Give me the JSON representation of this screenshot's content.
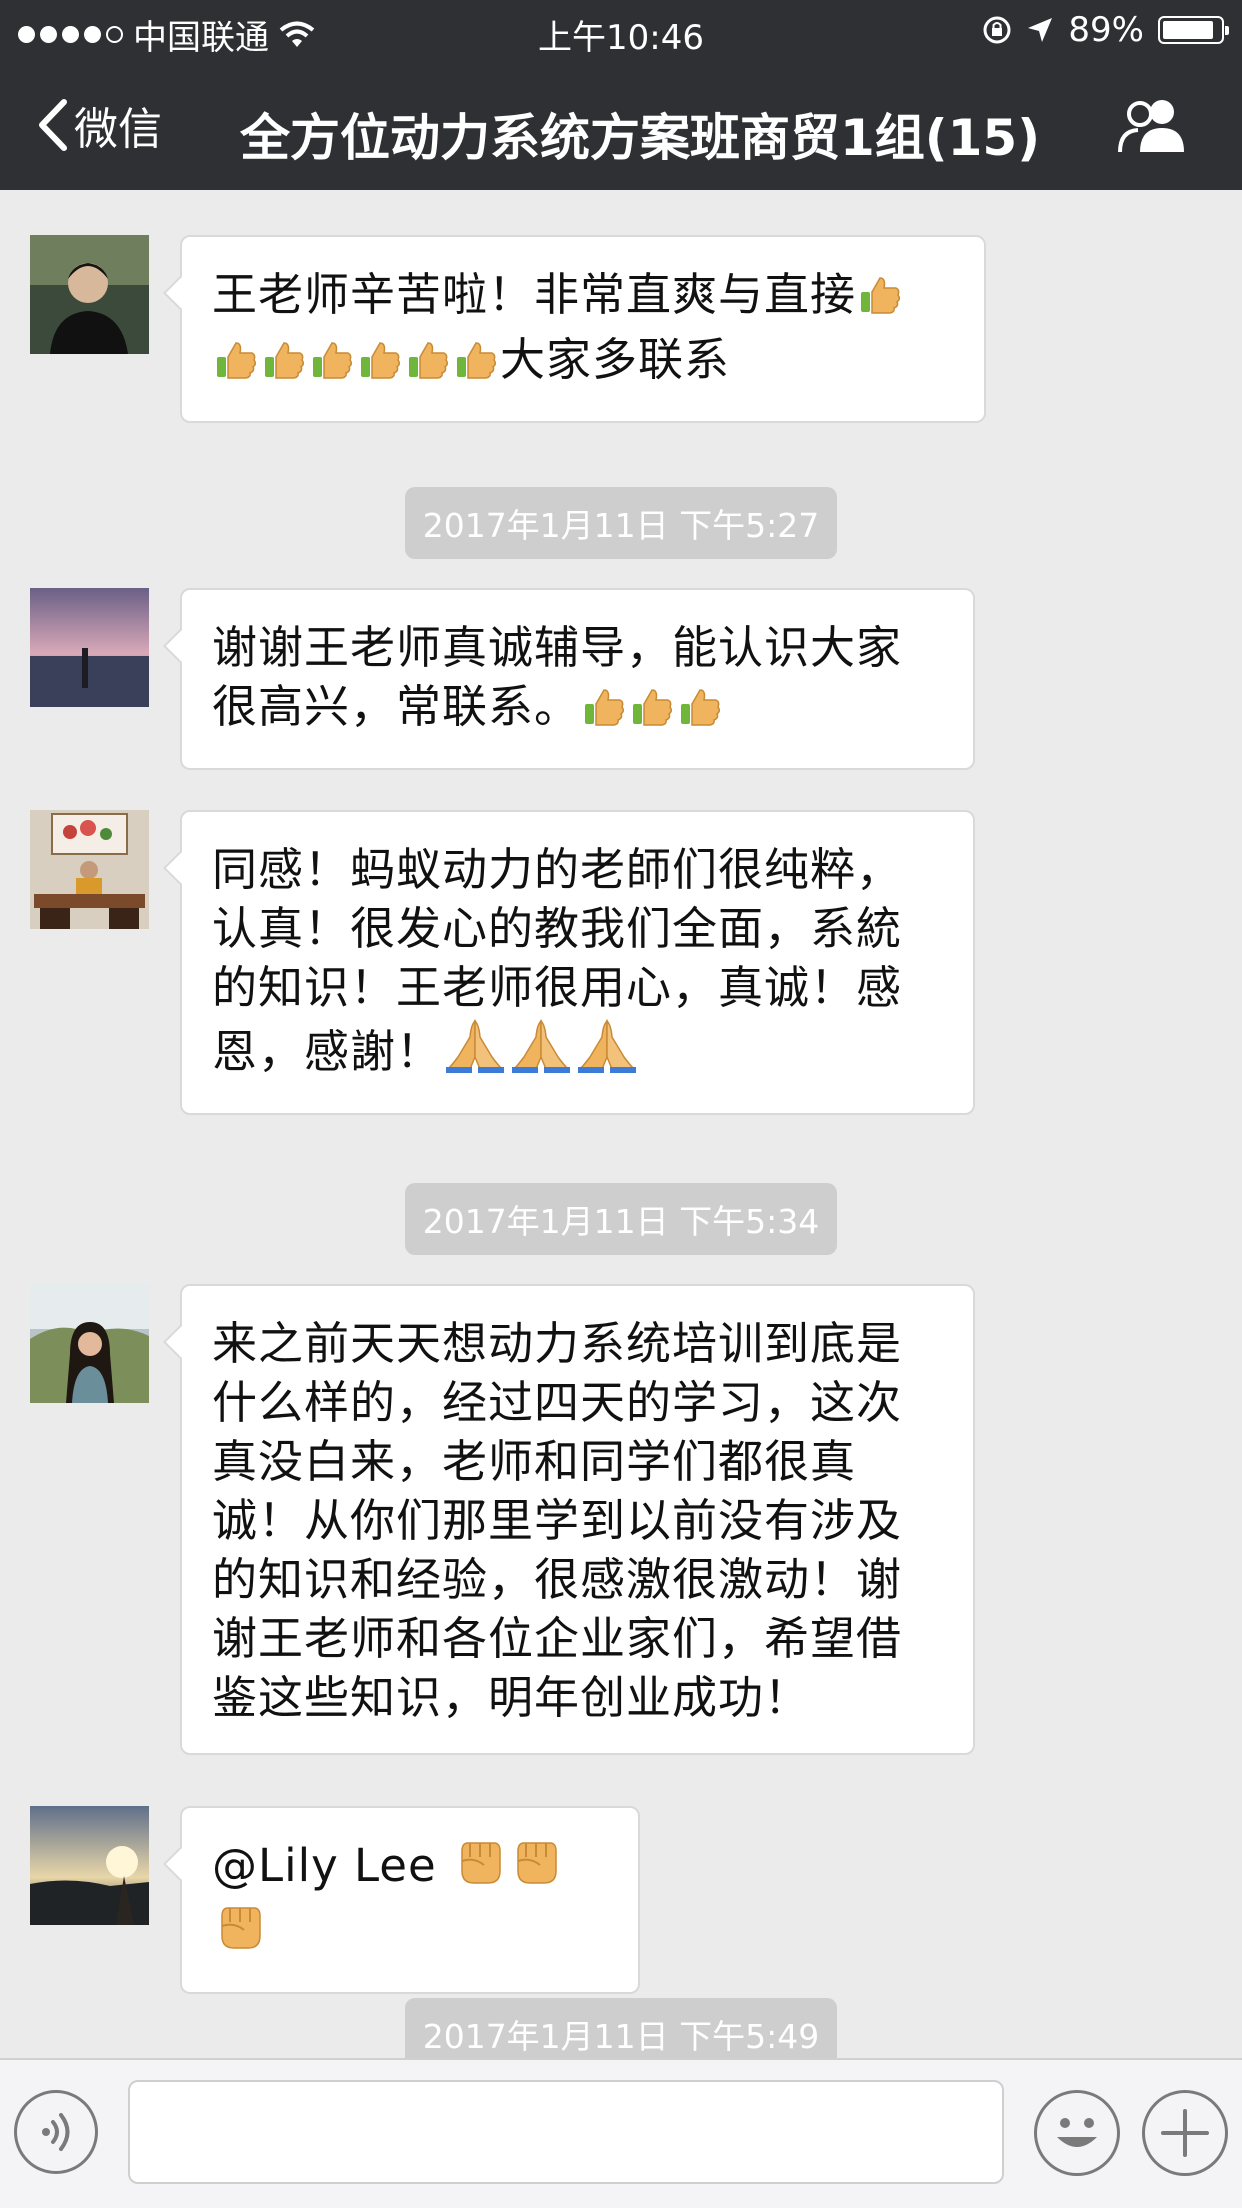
{
  "status_bar": {
    "carrier": "中国联通",
    "time": "上午10:46",
    "battery_text": "89%",
    "battery_level": 0.89
  },
  "nav": {
    "back_label": "微信",
    "title": "全方位动力系统方案班商贸1组(15)"
  },
  "chat": {
    "messages": [
      {
        "text_1": "王老师辛苦啦！非常直爽与直接",
        "text_2": "大家多联系"
      },
      {
        "text_1": "谢谢王老师真诚辅导，能认识大家",
        "text_2": "很高兴，常联系。"
      },
      {
        "line_1": "同感！蚂蚁动力的老師们很纯粹，",
        "line_2": "认真！很发心的教我们全面，系統",
        "line_3": "的知识！王老师很用心，真诚！感",
        "line_4": "恩，感謝！"
      },
      {
        "line_1": "来之前天天想动力系统培训到底是",
        "line_2": "什么样的，经过四天的学习，这次",
        "line_3": "真没白来，老师和同学们都很真",
        "line_4": "诚！从你们那里学到以前没有涉及",
        "line_5": "的知识和经验，很感激很激动！谢",
        "line_6": "谢王老师和各位企业家们，希望借",
        "line_7": "鉴这些知识，明年创业成功！"
      },
      {
        "text_1": "@Lily Lee"
      }
    ],
    "timestamps": [
      "2017年1月11日 下午5:27",
      "2017年1月11日 下午5:34",
      "2017年1月11日 下午5:49"
    ]
  },
  "colors": {
    "nav_background": "#2f3034",
    "chat_background": "#ebebeb",
    "bubble": "#ffffff",
    "timestamp_background": "#cecece"
  },
  "icons": [
    "signal-dots",
    "wifi-icon",
    "orientation-lock-icon",
    "location-arrow-icon",
    "battery-icon",
    "chevron-left-icon",
    "group-members-icon",
    "thumbs-up-emoji",
    "folded-hands-emoji",
    "raised-fist-emoji",
    "voice-icon",
    "smiley-icon",
    "plus-icon"
  ]
}
